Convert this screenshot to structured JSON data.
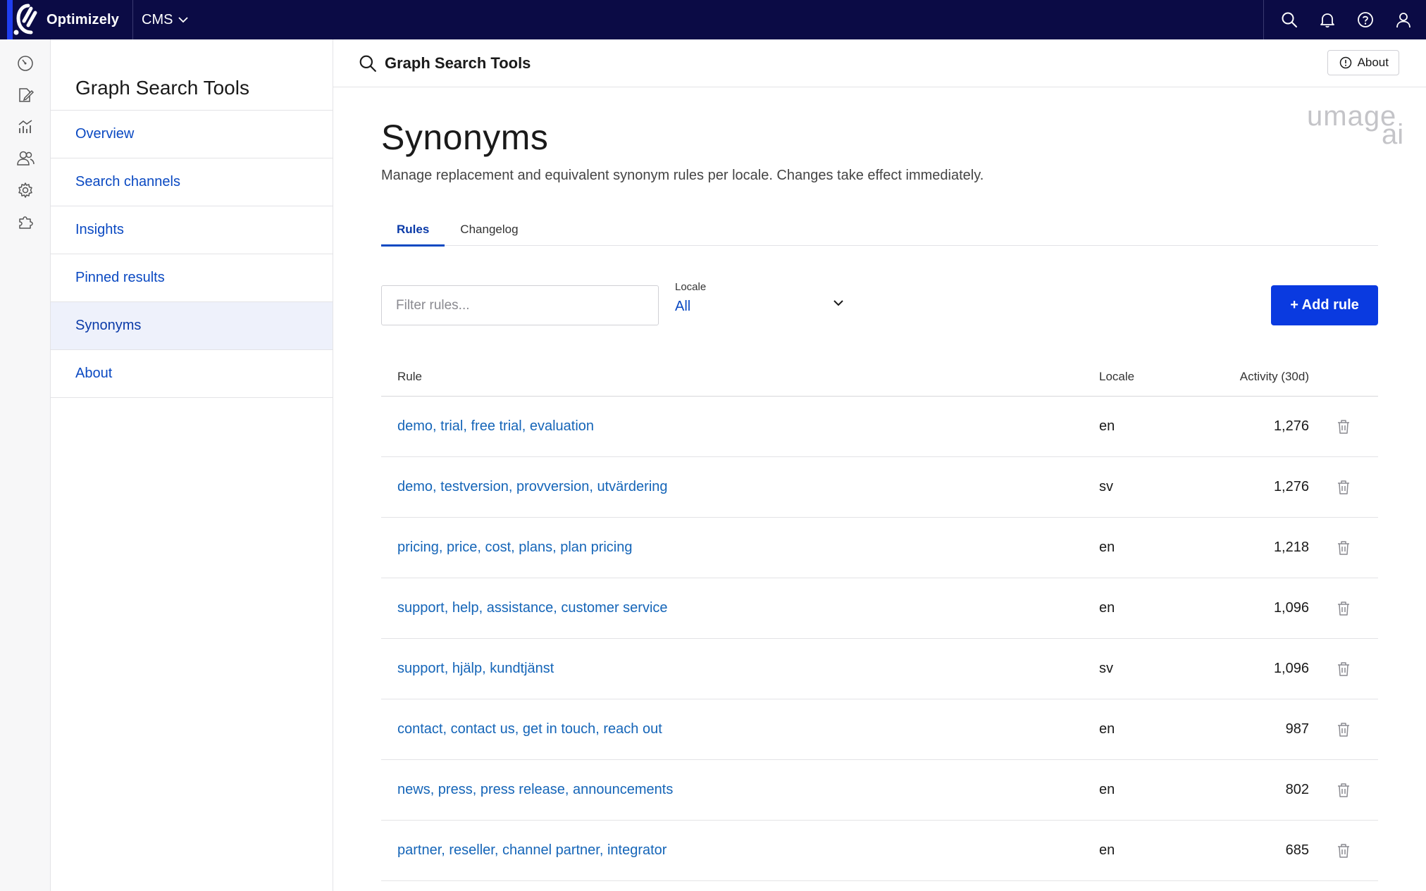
{
  "topbar": {
    "brand": "Optimizely",
    "product": "CMS",
    "actions": [
      "search-icon",
      "bell-icon",
      "help-icon",
      "user-icon"
    ]
  },
  "rail": {
    "icons": [
      "dashboard-icon",
      "edit-icon",
      "analytics-icon",
      "users-icon",
      "settings-icon",
      "addons-icon"
    ]
  },
  "subnav": {
    "title": "Graph Search Tools",
    "items": [
      {
        "label": "Overview"
      },
      {
        "label": "Search channels"
      },
      {
        "label": "Insights"
      },
      {
        "label": "Pinned results"
      },
      {
        "label": "Synonyms",
        "active": true
      },
      {
        "label": "About"
      }
    ]
  },
  "header": {
    "title": "Graph Search Tools",
    "about_label": "About"
  },
  "brand_mark": {
    "line1": "umage",
    "line2": "ai"
  },
  "page": {
    "title": "Synonyms",
    "description": "Manage replacement and equivalent synonym rules per locale. Changes take effect immediately."
  },
  "tabs": [
    {
      "label": "Rules",
      "active": true
    },
    {
      "label": "Changelog"
    }
  ],
  "toolbar": {
    "filter_placeholder": "Filter rules...",
    "locale_label": "Locale",
    "locale_value": "All",
    "add_label": "+ Add rule"
  },
  "table": {
    "headers": {
      "rule": "Rule",
      "locale": "Locale",
      "activity": "Activity (30d)"
    },
    "rows": [
      {
        "rule": "demo, trial, free trial, evaluation",
        "locale": "en",
        "activity": "1,276"
      },
      {
        "rule": "demo, testversion, provversion, utvärdering",
        "locale": "sv",
        "activity": "1,276"
      },
      {
        "rule": "pricing, price, cost, plans, plan pricing",
        "locale": "en",
        "activity": "1,218"
      },
      {
        "rule": "support, help, assistance, customer service",
        "locale": "en",
        "activity": "1,096"
      },
      {
        "rule": "support, hjälp, kundtjänst",
        "locale": "sv",
        "activity": "1,096"
      },
      {
        "rule": "contact, contact us, get in touch, reach out",
        "locale": "en",
        "activity": "987"
      },
      {
        "rule": "news, press, press release, announcements",
        "locale": "en",
        "activity": "802"
      },
      {
        "rule": "partner, reseller, channel partner, integrator",
        "locale": "en",
        "activity": "685"
      }
    ]
  },
  "colors": {
    "topbar": "#0b0b45",
    "primary": "#0a3ae0",
    "link": "#1565b8"
  }
}
